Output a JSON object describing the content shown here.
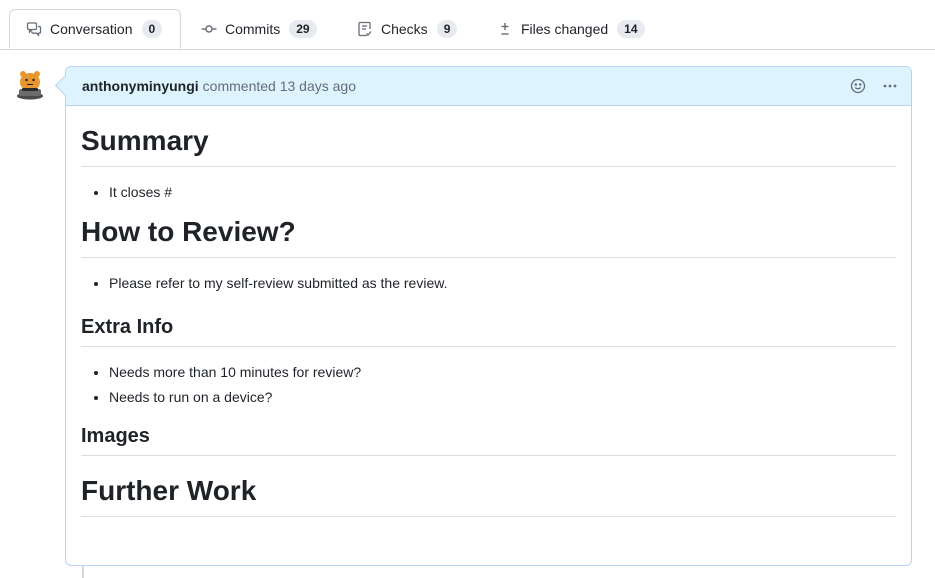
{
  "tabs": [
    {
      "label": "Conversation",
      "count": "0"
    },
    {
      "label": "Commits",
      "count": "29"
    },
    {
      "label": "Checks",
      "count": "9"
    },
    {
      "label": "Files changed",
      "count": "14"
    }
  ],
  "comment": {
    "author": "anthonyminyungi",
    "meta": "commented 13 days ago"
  },
  "body": {
    "summary_heading": "Summary",
    "summary_items": [
      "It closes #"
    ],
    "review_heading": "How to Review?",
    "review_items": [
      "Please refer to my self-review submitted as the review."
    ],
    "extra_heading": "Extra Info",
    "extra_items": [
      "Needs more than 10 minutes for review?",
      "Needs to run on a device?"
    ],
    "images_heading": "Images",
    "further_heading": "Further Work"
  },
  "icons": {
    "conversation": "comment-discussion-icon",
    "commits": "git-commit-icon",
    "checks": "checklist-icon",
    "files": "file-diff-icon",
    "emoji": "smiley-icon",
    "more": "kebab-horizontal-icon"
  },
  "colors": {
    "header_bg": "#ddf4ff",
    "border_accent": "#b6d3f2",
    "count_bg": "#e7eaee"
  }
}
